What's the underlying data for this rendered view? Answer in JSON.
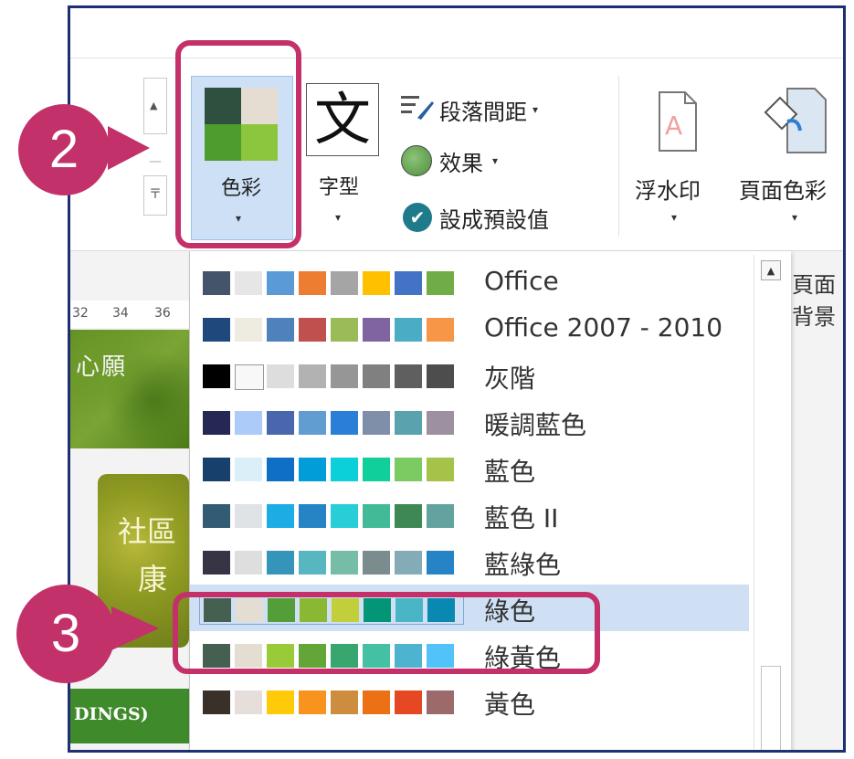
{
  "ribbon": {
    "color_button": {
      "label": "色彩",
      "chevron": "▾",
      "swatches": [
        "#2f4f3f",
        "#e5ddd2",
        "#4f9c2e",
        "#8cc63f"
      ]
    },
    "font_button": {
      "glyph": "文",
      "label": "字型",
      "chevron": "▾"
    },
    "paragraph_spacing": {
      "label": "段落間距",
      "chevron": "▾",
      "icon": "paragraph-spacing-icon"
    },
    "effects": {
      "label": "效果",
      "chevron": "▾",
      "icon": "effects-icon"
    },
    "set_default": {
      "label": "設成預設值",
      "icon": "check-icon",
      "check": "✔"
    },
    "watermark": {
      "label": "浮水印",
      "chevron": "▾",
      "icon": "watermark-icon"
    },
    "page_color": {
      "label": "頁面色彩",
      "chevron": "▾",
      "icon": "page-color-icon"
    },
    "spinner": {
      "up": "▲",
      "eq": "〒"
    }
  },
  "background_group_label": "頁面背景",
  "document": {
    "ruler_marks": [
      "32",
      "34",
      "36"
    ],
    "banner_text": "心願",
    "tile_text_1": "社區",
    "tile_text_2": "康",
    "bar_text": "DINGS)"
  },
  "dropdown": {
    "items": [
      {
        "label": "Office",
        "colors": [
          "#44546a",
          "#e7e6e6",
          "#5b9bd5",
          "#ed7d31",
          "#a5a5a5",
          "#ffc000",
          "#4472c4",
          "#70ad47"
        ]
      },
      {
        "label": "Office 2007 - 2010",
        "colors": [
          "#1f497d",
          "#eeece1",
          "#4f81bd",
          "#c0504d",
          "#9bbb59",
          "#8064a2",
          "#4bacc6",
          "#f79646"
        ]
      },
      {
        "label": "灰階",
        "colors": [
          "#000000",
          "#f8f8f8",
          "#dddddd",
          "#b2b2b2",
          "#969696",
          "#808080",
          "#5f5f5f",
          "#4d4d4d"
        ]
      },
      {
        "label": "暖調藍色",
        "colors": [
          "#242852",
          "#accbf9",
          "#4a66ac",
          "#629dd1",
          "#297fd5",
          "#7f8fa9",
          "#5aa2ae",
          "#9d90a0"
        ]
      },
      {
        "label": "藍色",
        "colors": [
          "#17406d",
          "#dbeff9",
          "#0f6fc6",
          "#009dd9",
          "#0bd0d9",
          "#10cf9b",
          "#7cca62",
          "#a5c249"
        ]
      },
      {
        "label": "藍色 II",
        "colors": [
          "#335b74",
          "#dfe3e5",
          "#1cade4",
          "#2683c6",
          "#27ced7",
          "#42ba97",
          "#3e8853",
          "#62a39f"
        ]
      },
      {
        "label": "藍綠色",
        "colors": [
          "#373545",
          "#dedede",
          "#3494ba",
          "#58b6c0",
          "#75bda7",
          "#7a8c8e",
          "#84acb6",
          "#2683c6"
        ]
      },
      {
        "label": "綠色",
        "colors": [
          "#455f51",
          "#e3ded1",
          "#549e39",
          "#8ab833",
          "#c0cf3a",
          "#029676",
          "#4ab5c4",
          "#0989b1"
        ]
      },
      {
        "label": "綠黃色",
        "colors": [
          "#455f51",
          "#e3ded1",
          "#99cb38",
          "#63a537",
          "#37a76f",
          "#44c1a3",
          "#4eb3cf",
          "#51c3f9"
        ]
      },
      {
        "label": "黃色",
        "colors": [
          "#39302a",
          "#e5dedb",
          "#ffca08",
          "#f8931d",
          "#ce8d3e",
          "#ec7016",
          "#e64823",
          "#9c6a6a"
        ]
      }
    ],
    "selected_index": 7,
    "scroll_up": "▲"
  },
  "callouts": [
    {
      "number": "2"
    },
    {
      "number": "3"
    }
  ],
  "accent_color": "#c3306a",
  "frame_color": "#1f2f73"
}
